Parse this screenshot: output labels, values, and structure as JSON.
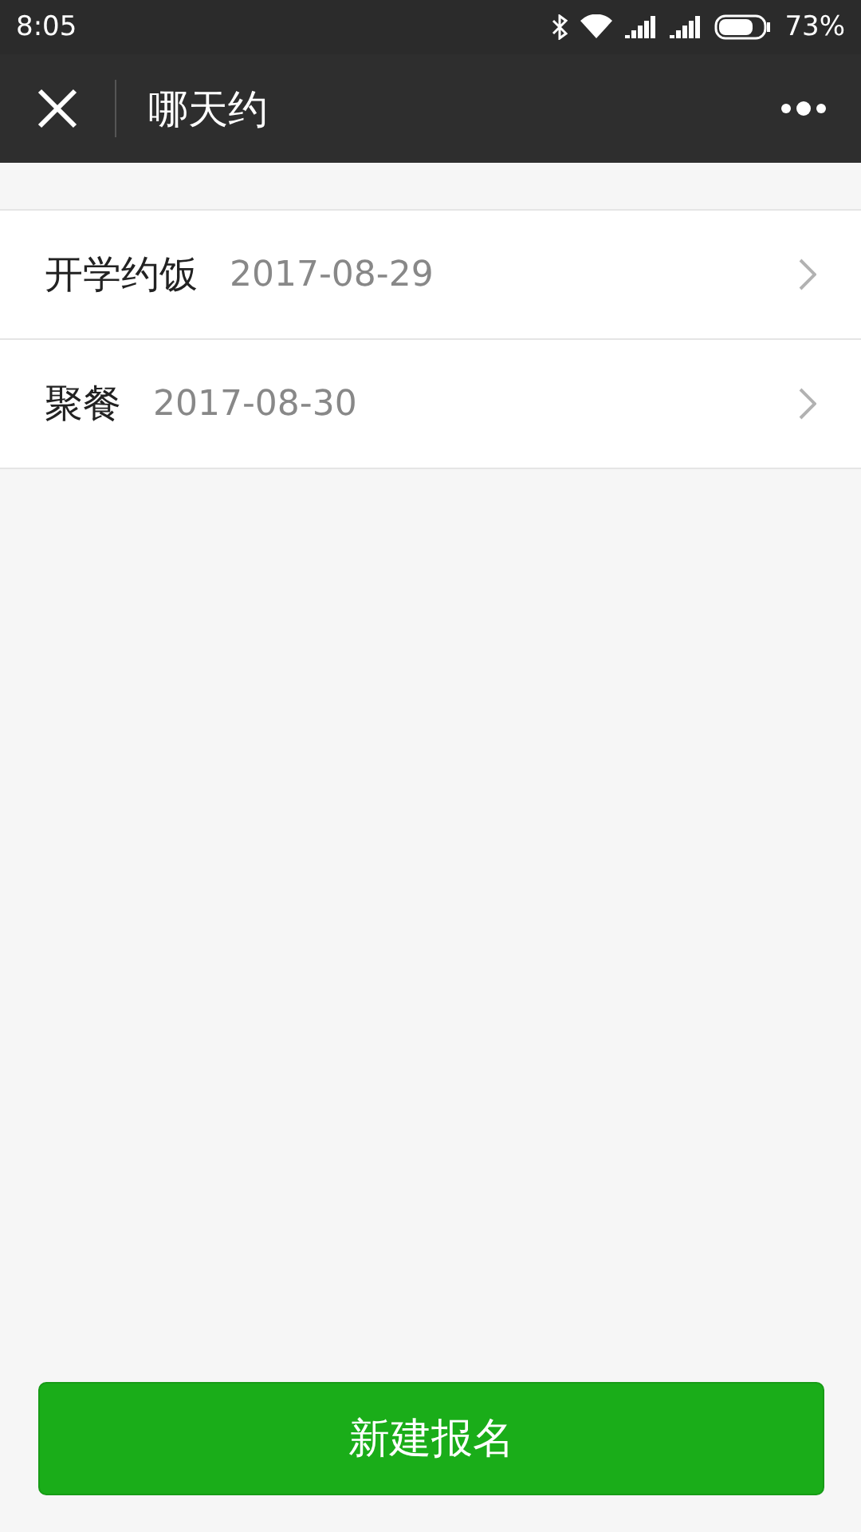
{
  "status_bar": {
    "time": "8:05",
    "battery": "73%"
  },
  "nav_bar": {
    "title": "哪天约"
  },
  "events": [
    {
      "name": "开学约饭",
      "date": "2017-08-29"
    },
    {
      "name": "聚餐",
      "date": "2017-08-30"
    }
  ],
  "primary_button": {
    "label": "新建报名"
  }
}
